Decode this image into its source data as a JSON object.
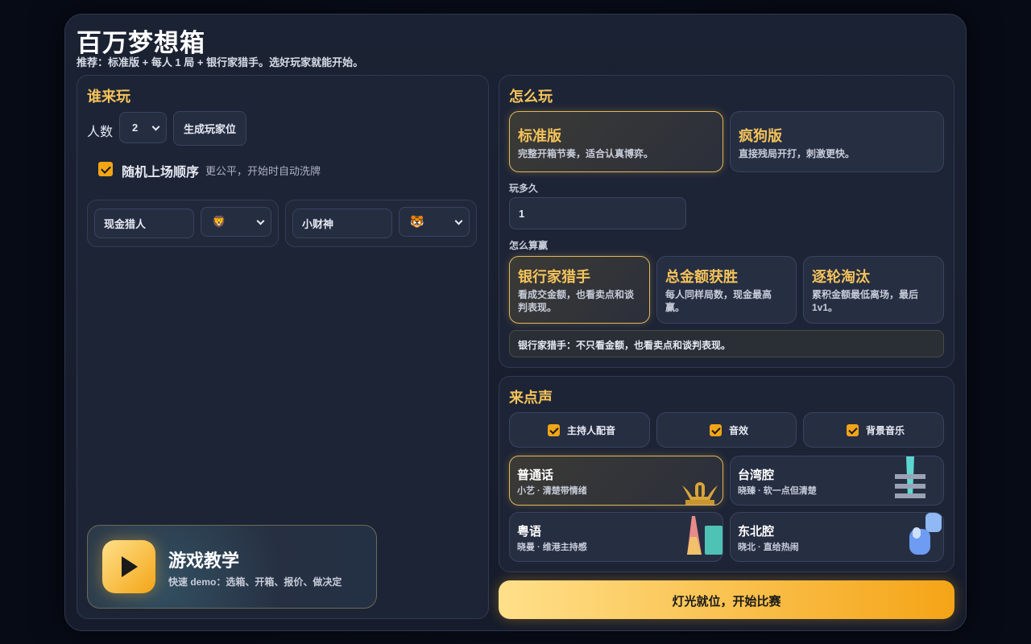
{
  "app": {
    "title": "百万梦想箱",
    "subtitle": "推荐：标准版 + 每人 1 局 + 银行家猎手。选好玩家就能开始。"
  },
  "players_panel": {
    "title": "谁来玩",
    "count_label": "人数",
    "count_value": "2",
    "generate_button": "生成玩家位",
    "shuffle_label": "随机上场顺序",
    "shuffle_hint": "更公平，开始时自动洗牌",
    "shuffle_checked": true,
    "players": [
      {
        "name": "现金猎人",
        "avatar": "🦁"
      },
      {
        "name": "小财神",
        "avatar": "🐯"
      }
    ]
  },
  "tutorial": {
    "title": "游戏教学",
    "desc": "快速 demo：选箱、开箱、报价、做决定",
    "icon": "play-icon"
  },
  "rules_panel": {
    "title": "怎么玩",
    "modes": [
      {
        "title": "标准版",
        "desc": "完整开箱节奏，适合认真博弈。",
        "selected": true
      },
      {
        "title": "疯狗版",
        "desc": "直接残局开打，刺激更快。",
        "selected": false
      }
    ],
    "rounds_label": "玩多久",
    "rounds_value": "1",
    "win_label": "怎么算赢",
    "win_modes": [
      {
        "title": "银行家猎手",
        "desc": "看成交金额，也看卖点和谈判表现。",
        "selected": true
      },
      {
        "title": "总金额获胜",
        "desc": "每人同样局数，现金最高赢。",
        "selected": false
      },
      {
        "title": "逐轮淘汰",
        "desc": "累积金额最低离场，最后 1v1。",
        "selected": false
      }
    ],
    "win_summary": "银行家猎手：不只看金额，也看卖点和谈判表现。"
  },
  "sound_panel": {
    "title": "来点声",
    "toggles": [
      {
        "label": "主持人配音",
        "checked": true
      },
      {
        "label": "音效",
        "checked": true
      },
      {
        "label": "背景音乐",
        "checked": true
      }
    ],
    "voices": [
      {
        "name": "普通话",
        "desc": "小艺 · 清楚带情绪",
        "selected": true,
        "icon": "landmark-icon"
      },
      {
        "name": "台湾腔",
        "desc": "晓臻 · 软一点但清楚",
        "selected": false,
        "icon": "tower-icon"
      },
      {
        "name": "粤语",
        "desc": "晓曼 · 维港主持感",
        "selected": false,
        "icon": "skyline-icon"
      },
      {
        "name": "东北腔",
        "desc": "晓北 · 直给热闹",
        "selected": false,
        "icon": "snow-icon"
      }
    ]
  },
  "start_button": "灯光就位，开始比赛",
  "colors": {
    "accent": "#f4c35a",
    "checkbox": "#f2a516",
    "start_gradient_from": "#ffe08a",
    "start_gradient_to": "#f5a416"
  }
}
